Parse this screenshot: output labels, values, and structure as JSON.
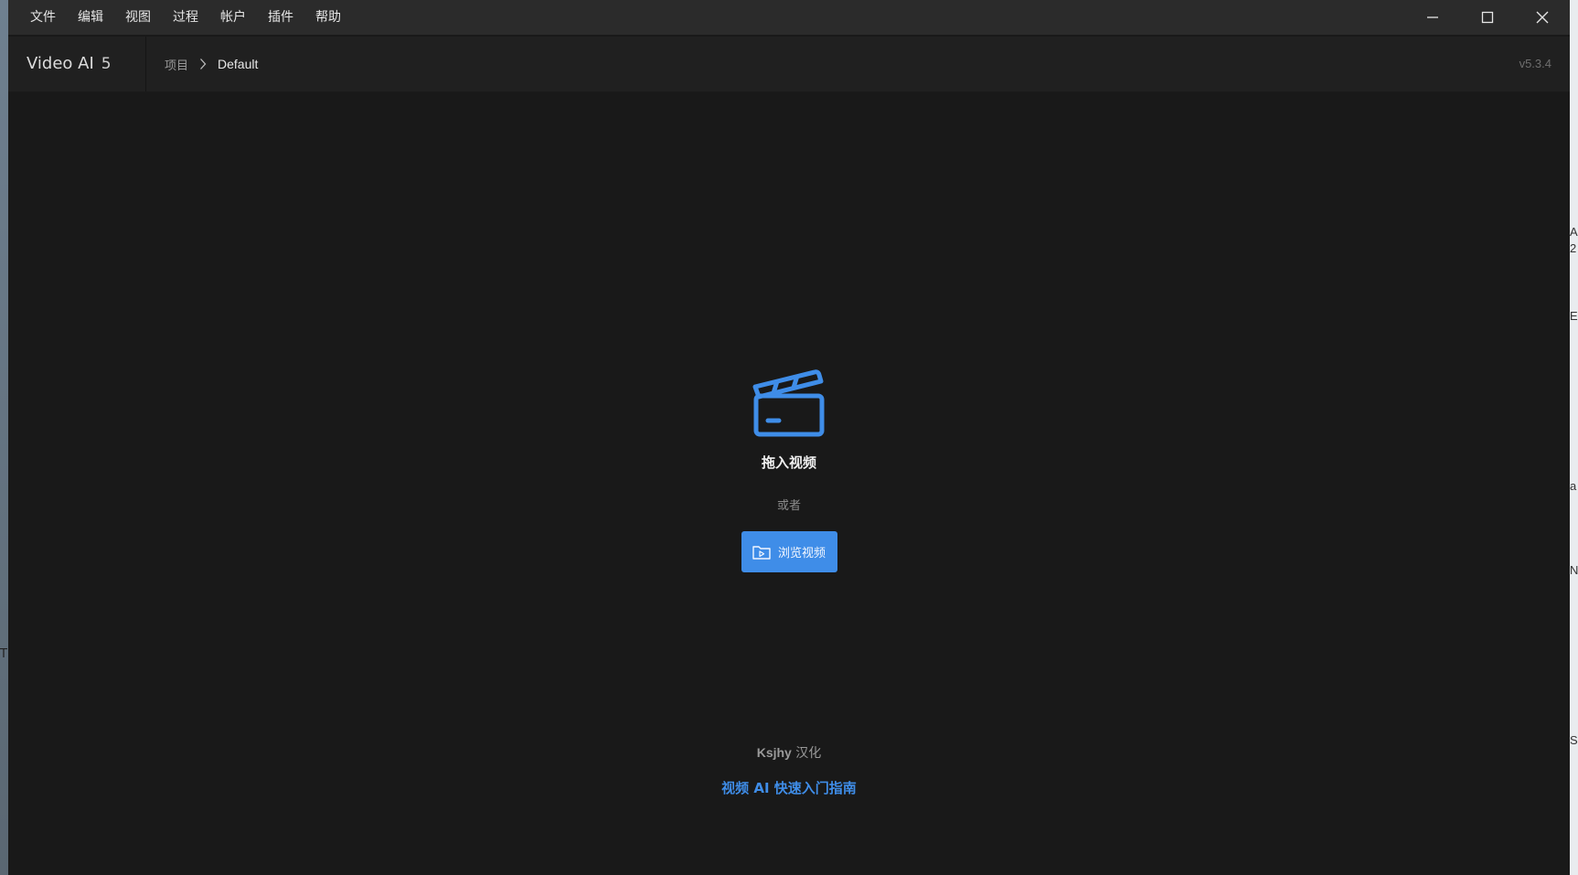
{
  "menu": {
    "items": [
      "文件",
      "编辑",
      "视图",
      "过程",
      "帐户",
      "插件",
      "帮助"
    ]
  },
  "header": {
    "app_name": "Video AI",
    "app_major": "5",
    "breadcrumb_root": "项目",
    "breadcrumb_current": "Default",
    "version": "v5.3.4"
  },
  "main": {
    "drop_label": "拖入视频",
    "or_label": "或者",
    "browse_label": "浏览视频",
    "credit_name": "Ksjhy",
    "credit_suffix": "汉化",
    "guide_link": "视频 AI 快速入门指南"
  },
  "desktop_right_chars": [
    "A",
    "2",
    "E",
    "a",
    "N",
    "S"
  ],
  "desktop_left_chars": [
    "T"
  ],
  "colors": {
    "accent": "#3f8de8",
    "background": "#191919",
    "menubar": "#2b2b2b",
    "header": "#202020"
  },
  "icons": {
    "minimize": "minimize-icon",
    "maximize": "maximize-icon",
    "close": "close-icon",
    "chevron": "chevron-right-icon",
    "clapper": "clapperboard-icon",
    "folder": "folder-video-icon"
  }
}
